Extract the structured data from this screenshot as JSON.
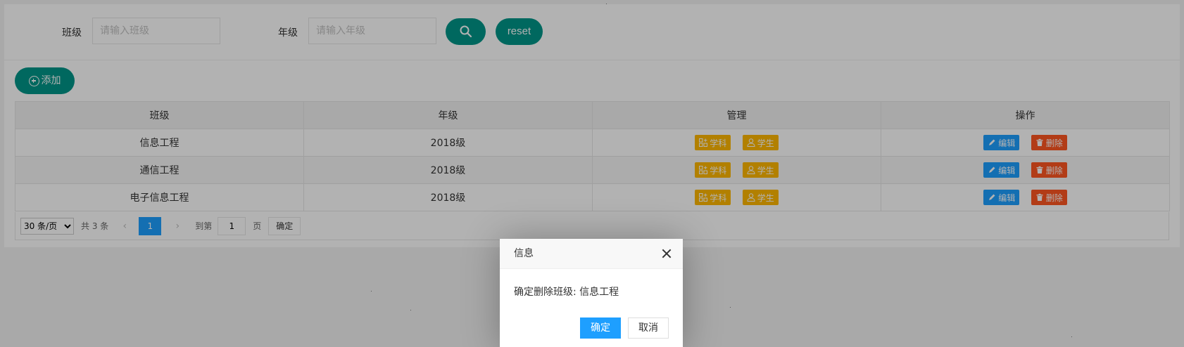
{
  "search": {
    "class_label": "班级",
    "class_placeholder": "请输入班级",
    "grade_label": "年级",
    "grade_placeholder": "请输入年级",
    "search_icon": "search-icon",
    "reset_label": "reset"
  },
  "toolbar": {
    "add_label": "添加",
    "add_icon": "plus-circle-icon"
  },
  "table": {
    "headers": [
      "班级",
      "年级",
      "管理",
      "操作"
    ],
    "rows": [
      {
        "class_name": "信息工程",
        "grade": "2018级"
      },
      {
        "class_name": "通信工程",
        "grade": "2018级"
      },
      {
        "class_name": "电子信息工程",
        "grade": "2018级"
      }
    ],
    "subject_label": "学科",
    "student_label": "学生",
    "edit_label": "编辑",
    "delete_label": "删除"
  },
  "pager": {
    "page_size": "30 条/页",
    "total": "共 3 条",
    "current_page": "1",
    "goto_label": "到第",
    "goto_value": "1",
    "page_unit": "页",
    "confirm_label": "确定"
  },
  "dialog": {
    "title": "信息",
    "message": "确定删除班级:  信息工程",
    "ok_label": "确定",
    "cancel_label": "取消"
  },
  "colors": {
    "teal": "#009688",
    "orange": "#ffb800",
    "blue": "#1e9fff",
    "red": "#ff5722"
  }
}
